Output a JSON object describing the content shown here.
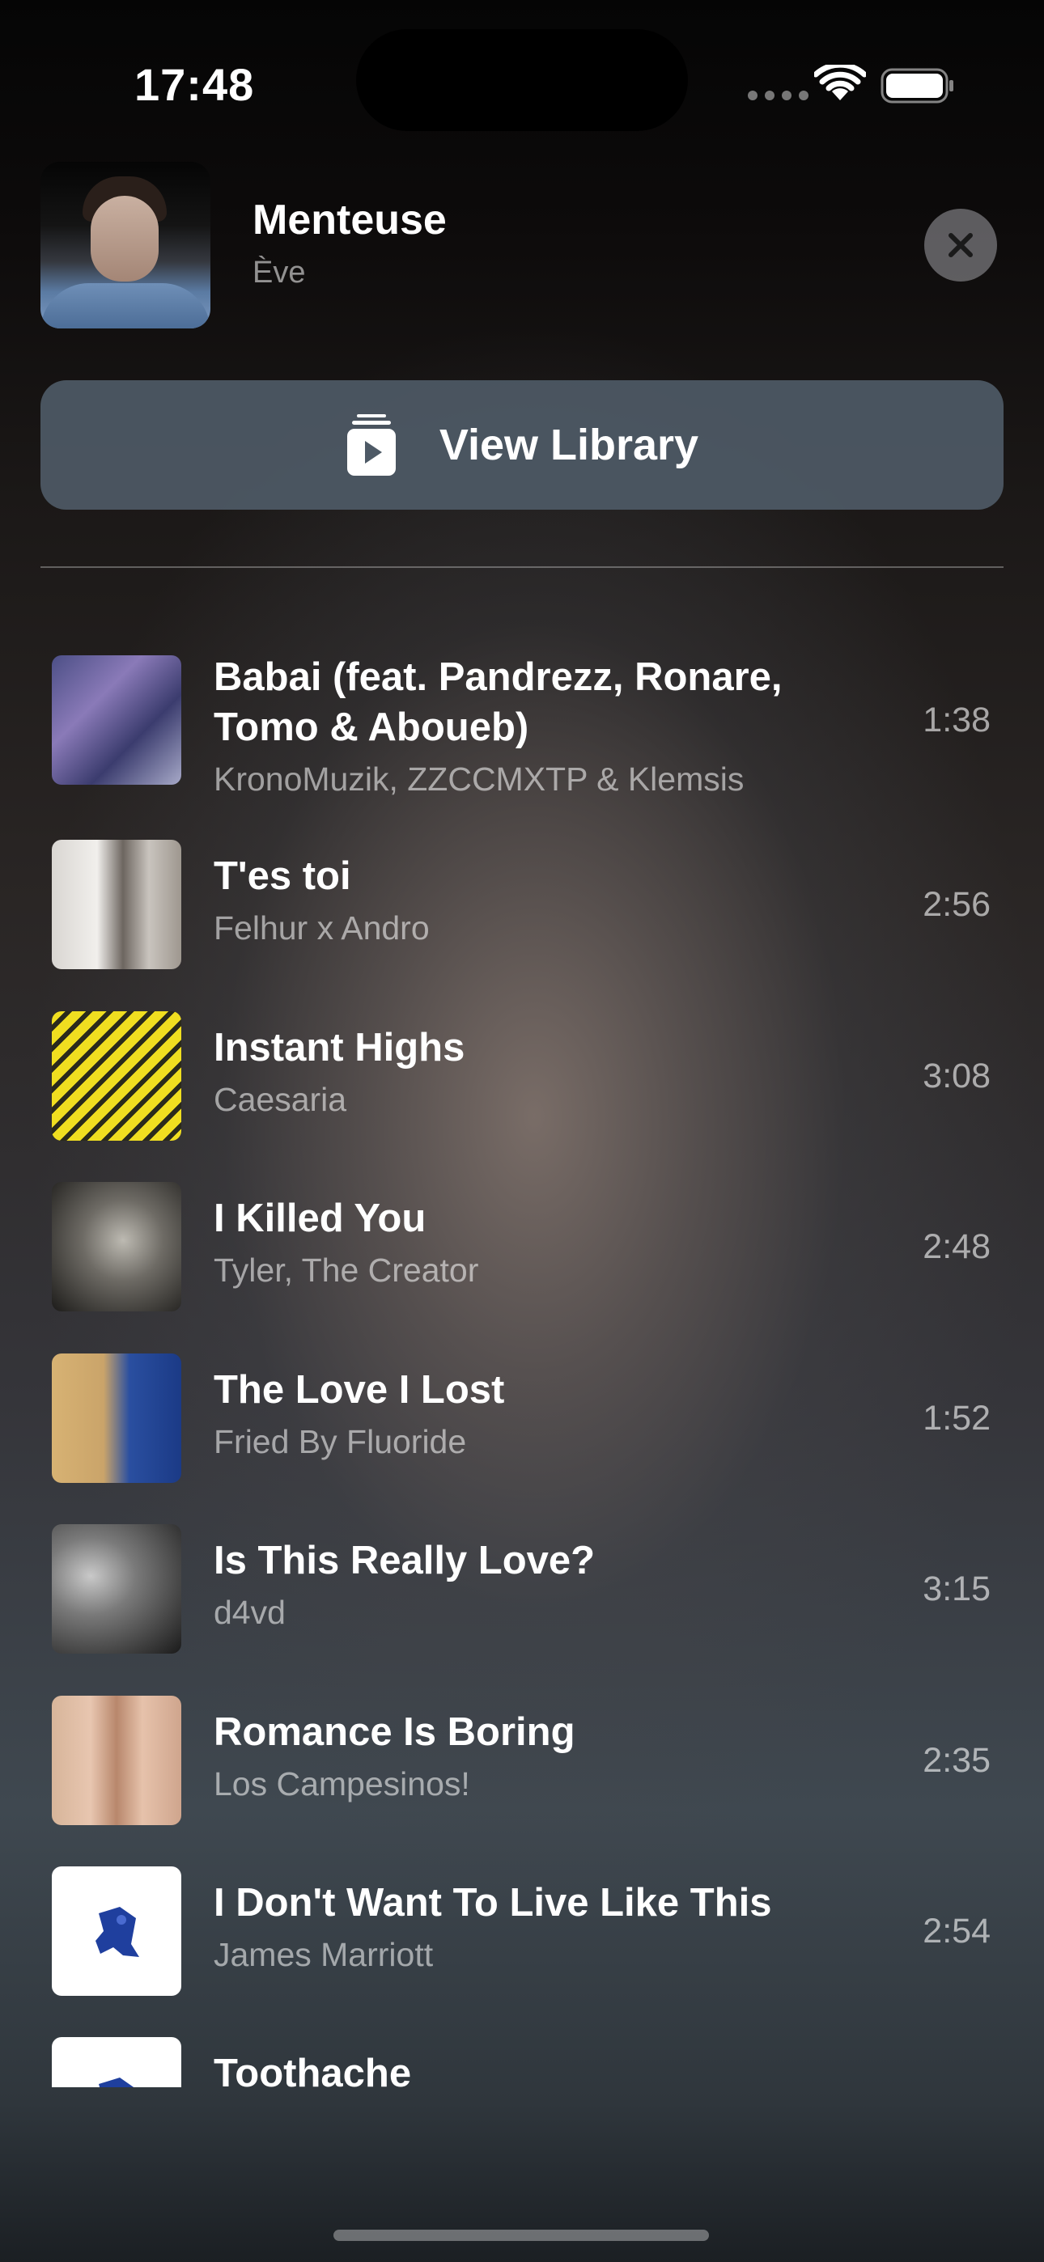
{
  "status_bar": {
    "time": "17:48",
    "wifi_icon": "wifi-icon",
    "battery_icon": "battery-icon"
  },
  "now_playing": {
    "title": "Menteuse",
    "artist": "Ève",
    "close_icon": "close-icon"
  },
  "library_button": {
    "label": "View Library",
    "icon": "music-library-icon"
  },
  "tracks": [
    {
      "title": "Babai (feat. Pandrezz, Ronare, Tomo & Aboueb)",
      "artist": "KronoMuzik, ZZCCMXTP & Klemsis",
      "duration": "1:38"
    },
    {
      "title": "T'es toi",
      "artist": "Felhur x Andro",
      "duration": "2:56"
    },
    {
      "title": "Instant Highs",
      "artist": "Caesaria",
      "duration": "3:08"
    },
    {
      "title": "I Killed You",
      "artist": "Tyler, The Creator",
      "duration": "2:48"
    },
    {
      "title": "The Love I Lost",
      "artist": "Fried By Fluoride",
      "duration": "1:52"
    },
    {
      "title": "Is This Really Love?",
      "artist": "d4vd",
      "duration": "3:15"
    },
    {
      "title": "Romance Is Boring",
      "artist": "Los Campesinos!",
      "duration": "2:35"
    },
    {
      "title": "I Don't Want To Live Like This",
      "artist": "James Marriott",
      "duration": "2:54"
    },
    {
      "title": "Toothache",
      "artist": "",
      "duration": ""
    }
  ]
}
